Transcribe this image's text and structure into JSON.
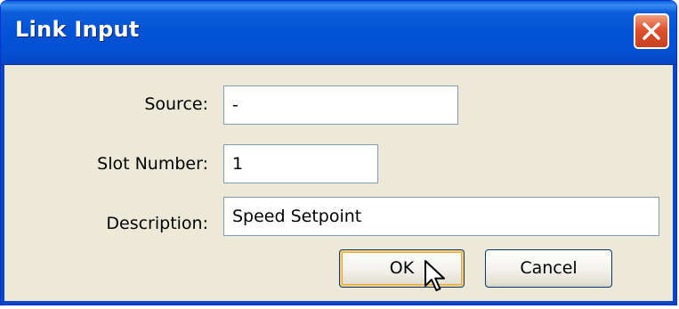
{
  "window": {
    "title": "Link Input"
  },
  "form": {
    "source_label": "Source:",
    "source_value": "-",
    "slot_label": "Slot Number:",
    "slot_value": "1",
    "description_label": "Description:",
    "description_value": "Speed Setpoint"
  },
  "buttons": {
    "ok_label": "OK",
    "cancel_label": "Cancel"
  },
  "icons": {
    "close": "close-icon",
    "cursor": "mouse-pointer-icon"
  },
  "colors": {
    "titlebar": "#0453d6",
    "close_button": "#e0512e",
    "dialog_background": "#ece9d8",
    "default_button_highlight": "#f7cd7c"
  }
}
